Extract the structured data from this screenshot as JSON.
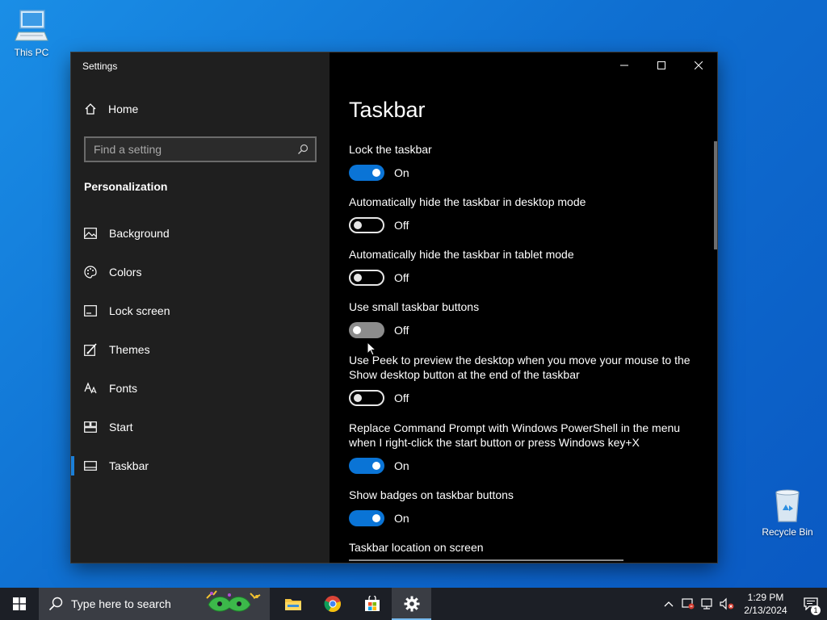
{
  "desktop": {
    "icons": [
      {
        "label": "This PC",
        "icon": "computer-icon"
      },
      {
        "label": "Recycle Bin",
        "icon": "recycle-bin-icon"
      }
    ]
  },
  "window": {
    "title": "Settings",
    "controls": {
      "minimize": "minimize-icon",
      "maximize": "maximize-icon",
      "close": "close-icon"
    }
  },
  "sidebar": {
    "home_label": "Home",
    "search_placeholder": "Find a setting",
    "section": "Personalization",
    "items": [
      {
        "label": "Background",
        "icon": "picture-icon"
      },
      {
        "label": "Colors",
        "icon": "palette-icon"
      },
      {
        "label": "Lock screen",
        "icon": "lock-screen-icon"
      },
      {
        "label": "Themes",
        "icon": "brush-icon"
      },
      {
        "label": "Fonts",
        "icon": "font-icon"
      },
      {
        "label": "Start",
        "icon": "start-grid-icon"
      },
      {
        "label": "Taskbar",
        "icon": "taskbar-icon",
        "active": true
      }
    ]
  },
  "main": {
    "title": "Taskbar",
    "settings": [
      {
        "label": "Lock the taskbar",
        "state": "On"
      },
      {
        "label": "Automatically hide the taskbar in desktop mode",
        "state": "Off"
      },
      {
        "label": "Automatically hide the taskbar in tablet mode",
        "state": "Off"
      },
      {
        "label": "Use small taskbar buttons",
        "state": "Off"
      },
      {
        "label": "Use Peek to preview the desktop when you move your mouse to the Show desktop button at the end of the taskbar",
        "state": "Off"
      },
      {
        "label": "Replace Command Prompt with Windows PowerShell in the menu when I right-click the start button or press Windows key+X",
        "state": "On"
      },
      {
        "label": "Show badges on taskbar buttons",
        "state": "On"
      }
    ],
    "location_label": "Taskbar location on screen"
  },
  "taskbar": {
    "search_placeholder": "Type here to search",
    "apps": [
      "file-explorer-icon",
      "chrome-icon",
      "store-icon",
      "settings-gear-icon"
    ],
    "time": "1:29 PM",
    "date": "2/13/2024",
    "notification_count": "1"
  },
  "colors": {
    "accent": "#0a74d6",
    "sidebar_bg": "#1f1f1f",
    "main_bg": "#000000"
  }
}
